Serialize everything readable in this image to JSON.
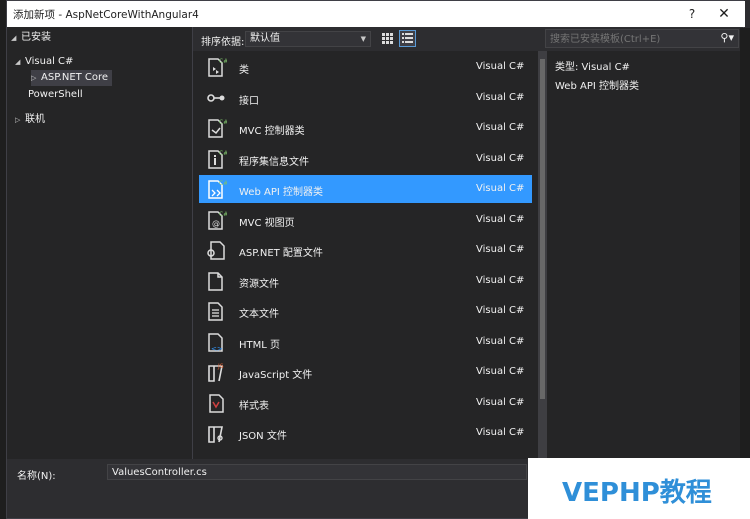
{
  "window": {
    "title": "添加新项 - AspNetCoreWithAngular4",
    "help": "?",
    "close": "✕"
  },
  "tree": {
    "installed": "已安装",
    "visual_csharp": "Visual C#",
    "aspnet_core": "ASP.NET Core",
    "powershell": "PowerShell",
    "online": "联机"
  },
  "toolbar": {
    "sort_label": "排序依据:",
    "sort_value": "默认值"
  },
  "search": {
    "placeholder": "搜索已安装模板(Ctrl+E)"
  },
  "templates": [
    {
      "name": "类",
      "lang": "Visual C#",
      "icon": "class-icon",
      "selected": false
    },
    {
      "name": "接口",
      "lang": "Visual C#",
      "icon": "interface-icon",
      "selected": false
    },
    {
      "name": "MVC 控制器类",
      "lang": "Visual C#",
      "icon": "mvc-controller-icon",
      "selected": false
    },
    {
      "name": "程序集信息文件",
      "lang": "Visual C#",
      "icon": "assembly-info-icon",
      "selected": false
    },
    {
      "name": "Web API 控制器类",
      "lang": "Visual C#",
      "icon": "webapi-controller-icon",
      "selected": true
    },
    {
      "name": "MVC 视图页",
      "lang": "Visual C#",
      "icon": "mvc-view-icon",
      "selected": false
    },
    {
      "name": "ASP.NET 配置文件",
      "lang": "Visual C#",
      "icon": "config-file-icon",
      "selected": false
    },
    {
      "name": "资源文件",
      "lang": "Visual C#",
      "icon": "resource-file-icon",
      "selected": false
    },
    {
      "name": "文本文件",
      "lang": "Visual C#",
      "icon": "text-file-icon",
      "selected": false
    },
    {
      "name": "HTML 页",
      "lang": "Visual C#",
      "icon": "html-page-icon",
      "selected": false
    },
    {
      "name": "JavaScript 文件",
      "lang": "Visual C#",
      "icon": "javascript-file-icon",
      "selected": false
    },
    {
      "name": "样式表",
      "lang": "Visual C#",
      "icon": "stylesheet-icon",
      "selected": false
    },
    {
      "name": "JSON 文件",
      "lang": "Visual C#",
      "icon": "json-file-icon",
      "selected": false
    }
  ],
  "details": {
    "type": "类型:  Visual C#",
    "description": "Web API 控制器类"
  },
  "bottom": {
    "name_label": "名称(N):",
    "name_value": "ValuesController.cs"
  },
  "watermark": "VEPHP教程",
  "colors": {
    "selection": "#3399ff",
    "background": "#2d2d30",
    "panel": "#252526",
    "watermark": "#2f8fd8"
  }
}
